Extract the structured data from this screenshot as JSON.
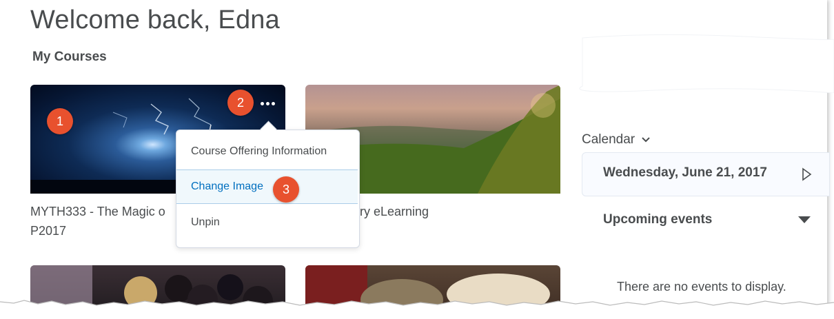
{
  "header": {
    "welcome": "Welcome back, Edna",
    "section_title": "My Courses"
  },
  "courses": [
    {
      "title_line1": "MYTH333 - The Magic o",
      "title_line2": "P2017"
    },
    {
      "title_line1": "ry eLearning"
    }
  ],
  "context_menu": {
    "items": [
      "Course Offering Information",
      "Change Image",
      "Unpin"
    ]
  },
  "badges": {
    "b1": "1",
    "b2": "2",
    "b3": "3"
  },
  "calendar": {
    "label": "Calendar",
    "date": "Wednesday, June 21, 2017",
    "upcoming": "Upcoming events",
    "empty": "There are no events to display."
  },
  "icons": {
    "more": "more-options-icon",
    "calendar_toggle": "chevron-down-icon",
    "next": "triangle-right-icon",
    "upcoming_toggle": "triangle-down-icon"
  },
  "colors": {
    "badge": "#e8512e",
    "link": "#006fbf",
    "text": "#494c4e"
  }
}
